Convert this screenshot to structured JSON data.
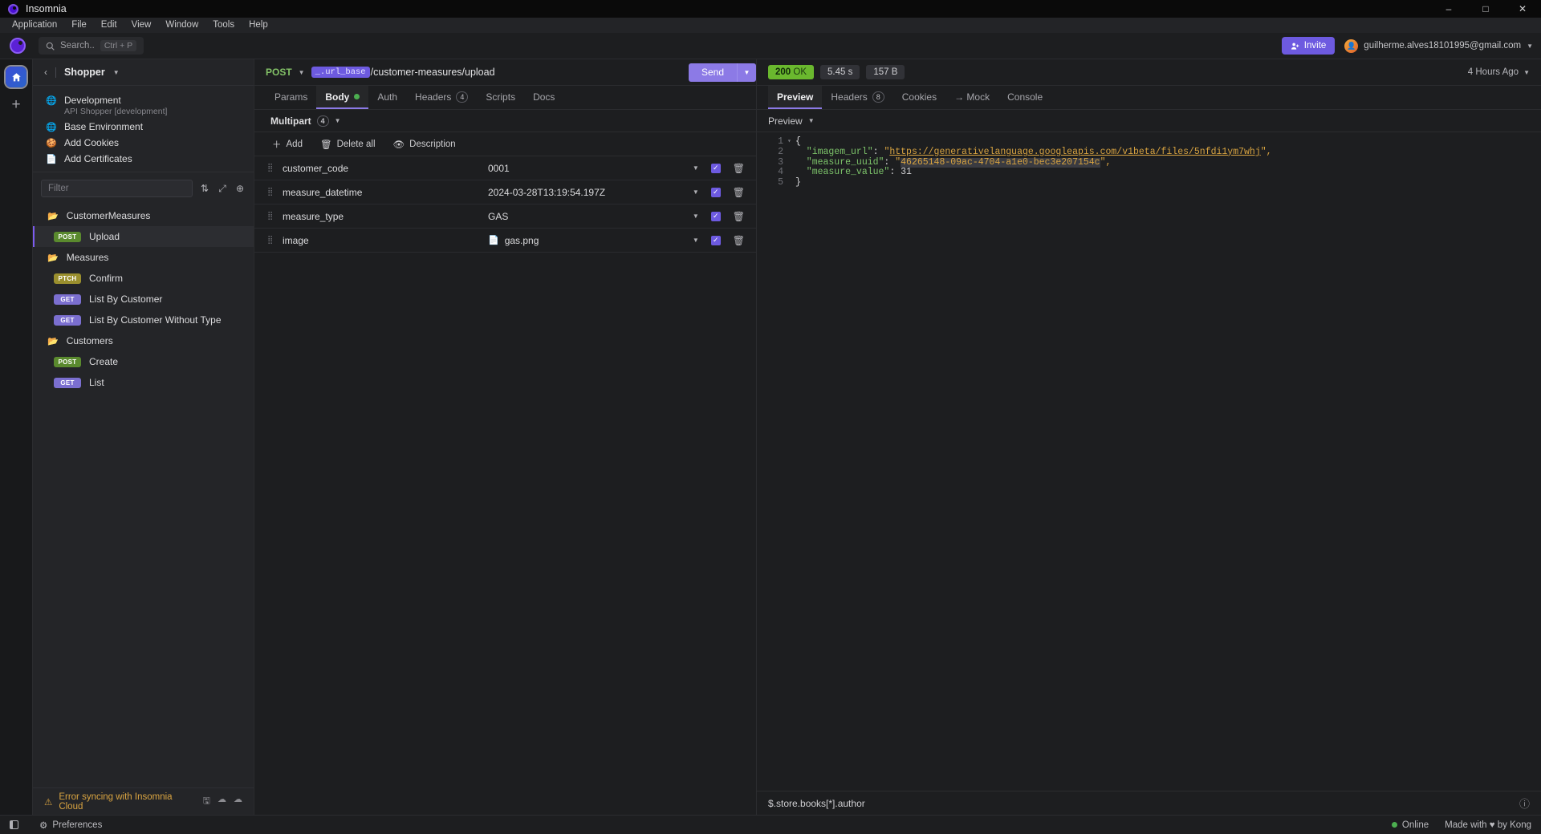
{
  "titlebar": {
    "app_name": "Insomnia",
    "minimize": "–",
    "maximize": "□",
    "close": "✕"
  },
  "menubar": {
    "items": [
      "Application",
      "File",
      "Edit",
      "View",
      "Window",
      "Tools",
      "Help"
    ]
  },
  "topbar": {
    "search_label": "Search..",
    "search_shortcut": "Ctrl + P",
    "invite_label": "Invite",
    "account_email": "guilherme.alves18101995@gmail.com"
  },
  "sidebar": {
    "workspace_name": "Shopper",
    "environments": [
      {
        "label": "Development",
        "sub": "API Shopper [development]",
        "icon": "globe-icon"
      },
      {
        "label": "Base Environment",
        "sub": "",
        "icon": "globe-icon"
      },
      {
        "label": "Add Cookies",
        "sub": "",
        "icon": "cookie-icon"
      },
      {
        "label": "Add Certificates",
        "sub": "",
        "icon": "certificate-icon"
      }
    ],
    "filter_placeholder": "Filter",
    "tree": [
      {
        "type": "folder",
        "label": "CustomerMeasures"
      },
      {
        "type": "request",
        "method": "POST",
        "method_class": "m-post",
        "label": "Upload",
        "active": true
      },
      {
        "type": "folder",
        "label": "Measures"
      },
      {
        "type": "request",
        "method": "PTCH",
        "method_class": "m-ptch",
        "label": "Confirm",
        "active": false
      },
      {
        "type": "request",
        "method": "GET",
        "method_class": "m-get",
        "label": "List By Customer",
        "active": false
      },
      {
        "type": "request",
        "method": "GET",
        "method_class": "m-get",
        "label": "List By Customer Without Type",
        "active": false
      },
      {
        "type": "folder",
        "label": "Customers"
      },
      {
        "type": "request",
        "method": "POST",
        "method_class": "m-post",
        "label": "Create",
        "active": false
      },
      {
        "type": "request",
        "method": "GET",
        "method_class": "m-get",
        "label": "List",
        "active": false
      }
    ],
    "footer_error": "Error syncing with Insomnia Cloud"
  },
  "request": {
    "method": "POST",
    "url_variable": "_.url_base",
    "url_path": "/customer-measures/upload",
    "send_label": "Send",
    "tabs": [
      {
        "label": "Params",
        "active": false,
        "badge": ""
      },
      {
        "label": "Body",
        "active": true,
        "badge": "dot"
      },
      {
        "label": "Auth",
        "active": false,
        "badge": ""
      },
      {
        "label": "Headers",
        "active": false,
        "badge": "4"
      },
      {
        "label": "Scripts",
        "active": false,
        "badge": ""
      },
      {
        "label": "Docs",
        "active": false,
        "badge": ""
      }
    ],
    "body_type": "Multipart",
    "body_count": "4",
    "toolbar": {
      "add": "Add",
      "delete_all": "Delete all",
      "description": "Description"
    },
    "params": [
      {
        "name": "customer_code",
        "value": "0001",
        "is_file": false,
        "enabled": true
      },
      {
        "name": "measure_datetime",
        "value": "2024-03-28T13:19:54.197Z",
        "is_file": false,
        "enabled": true
      },
      {
        "name": "measure_type",
        "value": "GAS",
        "is_file": false,
        "enabled": true
      },
      {
        "name": "image",
        "value": "gas.png",
        "is_file": true,
        "enabled": true
      }
    ]
  },
  "response": {
    "status_code": "200",
    "status_text": "OK",
    "elapsed": "5.45 s",
    "size": "157 B",
    "time_ago": "4 Hours Ago",
    "tabs": [
      {
        "label": "Preview",
        "active": true,
        "badge": ""
      },
      {
        "label": "Headers",
        "active": false,
        "badge": "8"
      },
      {
        "label": "Cookies",
        "active": false,
        "badge": ""
      },
      {
        "label": "→ Mock",
        "active": false,
        "badge": ""
      },
      {
        "label": "Console",
        "active": false,
        "badge": ""
      }
    ],
    "preview_mode": "Preview",
    "body_lines": [
      {
        "num": "1",
        "fold": true,
        "tokens": [
          {
            "t": "{",
            "c": "c-brace"
          }
        ]
      },
      {
        "num": "2",
        "fold": false,
        "tokens": [
          {
            "t": "  \"imagem_url\"",
            "c": "c-key"
          },
          {
            "t": ": ",
            "c": "c-brace"
          },
          {
            "t": "\"",
            "c": "c-str"
          },
          {
            "t": "https://generativelanguage.googleapis.com/v1beta/files/5nfdi1ym7whj",
            "c": "c-link"
          },
          {
            "t": "\",",
            "c": "c-str"
          }
        ]
      },
      {
        "num": "3",
        "fold": false,
        "tokens": [
          {
            "t": "  \"measure_uuid\"",
            "c": "c-key"
          },
          {
            "t": ": ",
            "c": "c-brace"
          },
          {
            "t": "\"",
            "c": "c-str"
          },
          {
            "t": "46265148-09ac-4704-a1e0-bec3e207154c",
            "c": "c-str c-sel"
          },
          {
            "t": "\",",
            "c": "c-str"
          }
        ]
      },
      {
        "num": "4",
        "fold": false,
        "tokens": [
          {
            "t": "  \"measure_value\"",
            "c": "c-key"
          },
          {
            "t": ": ",
            "c": "c-brace"
          },
          {
            "t": "31",
            "c": "c-num"
          }
        ]
      },
      {
        "num": "5",
        "fold": false,
        "tokens": [
          {
            "t": "}",
            "c": "c-brace"
          }
        ]
      }
    ],
    "filter_expression": "$.store.books[*].author"
  },
  "statusbar": {
    "preferences_label": "Preferences",
    "online_label": "Online",
    "made_with": "Made with ♥ by Kong"
  }
}
